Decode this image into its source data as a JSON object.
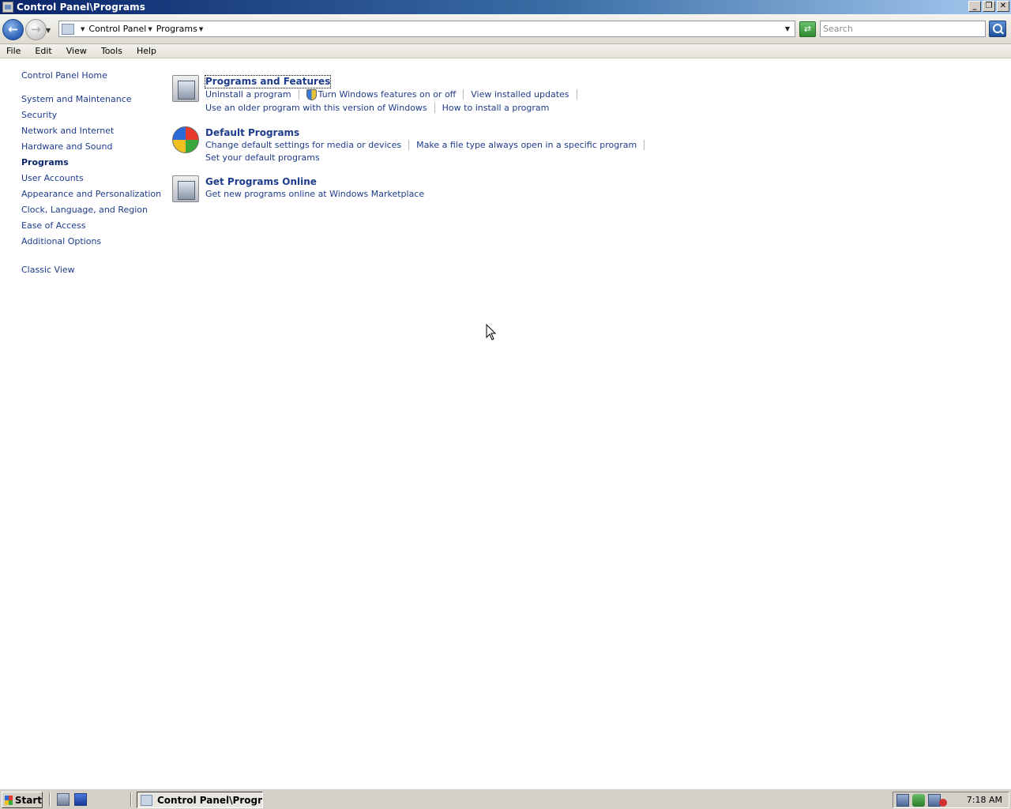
{
  "window": {
    "title": "Control Panel\\Programs",
    "buttons": {
      "minimize": "_",
      "restore": "❐",
      "close": "✕"
    }
  },
  "address_bar": {
    "breadcrumbs": [
      "Control Panel",
      "Programs"
    ],
    "search_placeholder": "Search"
  },
  "menu": [
    "File",
    "Edit",
    "View",
    "Tools",
    "Help"
  ],
  "sidebar": {
    "home": "Control Panel Home",
    "items": [
      "System and Maintenance",
      "Security",
      "Network and Internet",
      "Hardware and Sound",
      "Programs",
      "User Accounts",
      "Appearance and Personalization",
      "Clock, Language, and Region",
      "Ease of Access",
      "Additional Options"
    ],
    "current": "Programs",
    "classic_view": "Classic View"
  },
  "categories": [
    {
      "title": "Programs and Features",
      "icon": "programs-icon",
      "rows": [
        [
          "Uninstall a program",
          "Turn Windows features on or off",
          "View installed updates"
        ],
        [
          "Use an older program with this version of Windows",
          "How to install a program"
        ]
      ]
    },
    {
      "title": "Default Programs",
      "icon": "default-programs-icon",
      "rows": [
        [
          "Change default settings for media or devices",
          "Make a file type always open in a specific program"
        ],
        [
          "Set your default programs"
        ]
      ]
    },
    {
      "title": "Get Programs Online",
      "icon": "programs-online-icon",
      "rows": [
        [
          "Get new programs online at Windows Marketplace"
        ]
      ]
    }
  ],
  "taskbar": {
    "start_label": "Start",
    "task_button": "Control Panel\\Progra...",
    "clock": "7:18 AM"
  }
}
